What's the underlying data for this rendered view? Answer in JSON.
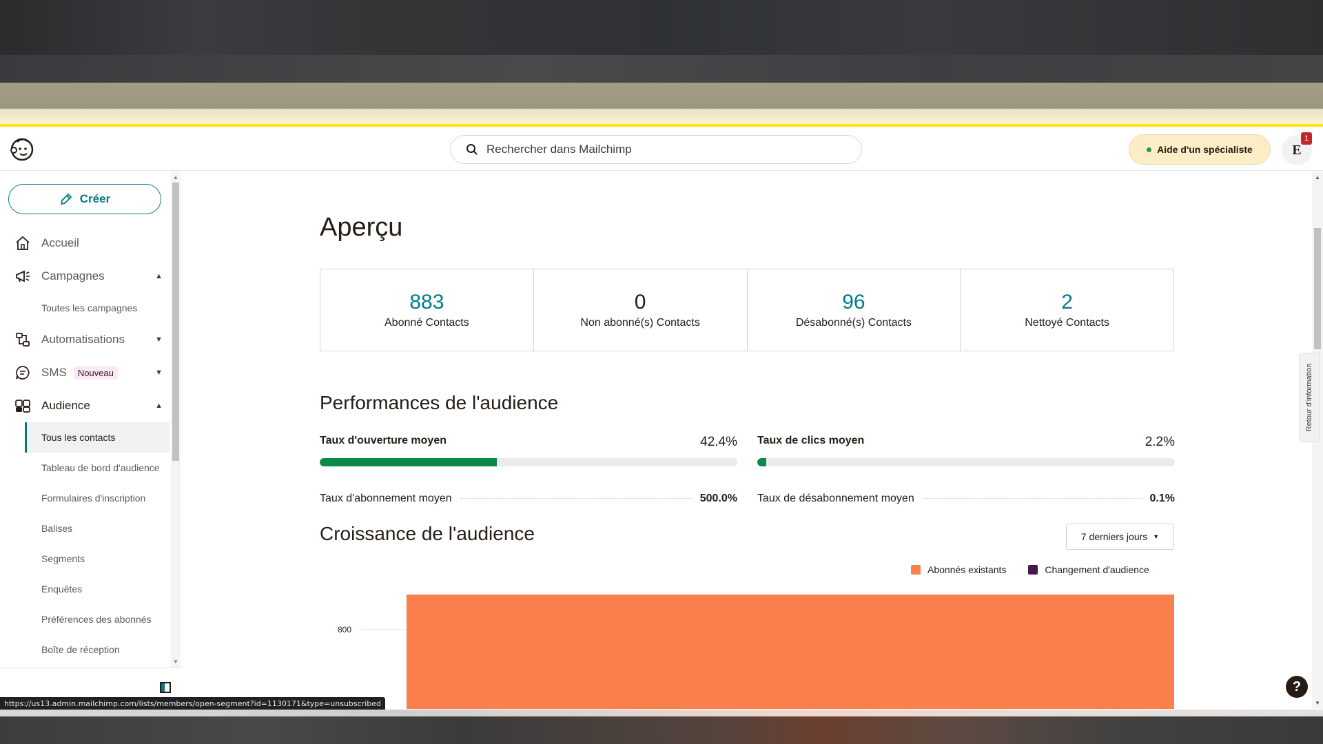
{
  "header": {
    "search_placeholder": "Rechercher dans Mailchimp",
    "expert_help_label": "Aide d'un spécialiste",
    "avatar_initial": "E",
    "notification_count": "1"
  },
  "sidebar": {
    "create_label": "Créer",
    "items": [
      {
        "label": "Accueil",
        "icon": "home-icon"
      },
      {
        "label": "Campagnes",
        "icon": "megaphone-icon",
        "expanded": true
      },
      {
        "label": "Automatisations",
        "icon": "automation-icon",
        "expanded": false
      },
      {
        "label": "SMS",
        "icon": "sms-icon",
        "badge": "Nouveau",
        "expanded": false
      },
      {
        "label": "Audience",
        "icon": "audience-icon",
        "expanded": true
      }
    ],
    "campaign_subitems": [
      "Toutes les campagnes"
    ],
    "audience_subitems": [
      "Tous les contacts",
      "Tableau de bord d'audience",
      "Formulaires d'inscription",
      "Balises",
      "Segments",
      "Enquêtes",
      "Préférences des abonnés",
      "Boîte de réception"
    ],
    "active_subitem": "Tous les contacts"
  },
  "main": {
    "title": "Aperçu",
    "stats": [
      {
        "value": "883",
        "label": "Abonné Contacts"
      },
      {
        "value": "0",
        "label": "Non abonné(s) Contacts"
      },
      {
        "value": "96",
        "label": "Désabonné(s) Contacts"
      },
      {
        "value": "2",
        "label": "Nettoyé Contacts"
      }
    ],
    "performance": {
      "title": "Performances de l'audience",
      "open_rate": {
        "label": "Taux d'ouverture moyen",
        "value": "42.4%",
        "fill": 0.424
      },
      "click_rate": {
        "label": "Taux de clics moyen",
        "value": "2.2%",
        "fill": 0.022
      },
      "subscribe_rate": {
        "label": "Taux d'abonnement moyen",
        "value": "500.0%"
      },
      "unsubscribe_rate": {
        "label": "Taux de désabonnement moyen",
        "value": "0.1%"
      }
    },
    "growth": {
      "title": "Croissance de l'audience",
      "range_label": "7 derniers jours",
      "legend": [
        {
          "name": "Abonnés existants",
          "color": "#f9804d"
        },
        {
          "name": "Changement d'audience",
          "color": "#4a1650"
        }
      ]
    }
  },
  "chart_data": {
    "type": "bar",
    "y_ticks": [
      "800"
    ],
    "series": [
      {
        "name": "Abonnés existants",
        "color": "#f9804d"
      },
      {
        "name": "Changement d'audience",
        "color": "#4a1650"
      }
    ]
  },
  "feedback_tab_label": "Retour d'information",
  "help_label": "?",
  "status_url": "https://us13.admin.mailchimp.com/lists/members/open-segment?id=1130171&type=unsubscribed",
  "colors": {
    "accent": "#007c89",
    "progress": "#0a8a4a",
    "banner_line": "#ffe01b"
  }
}
